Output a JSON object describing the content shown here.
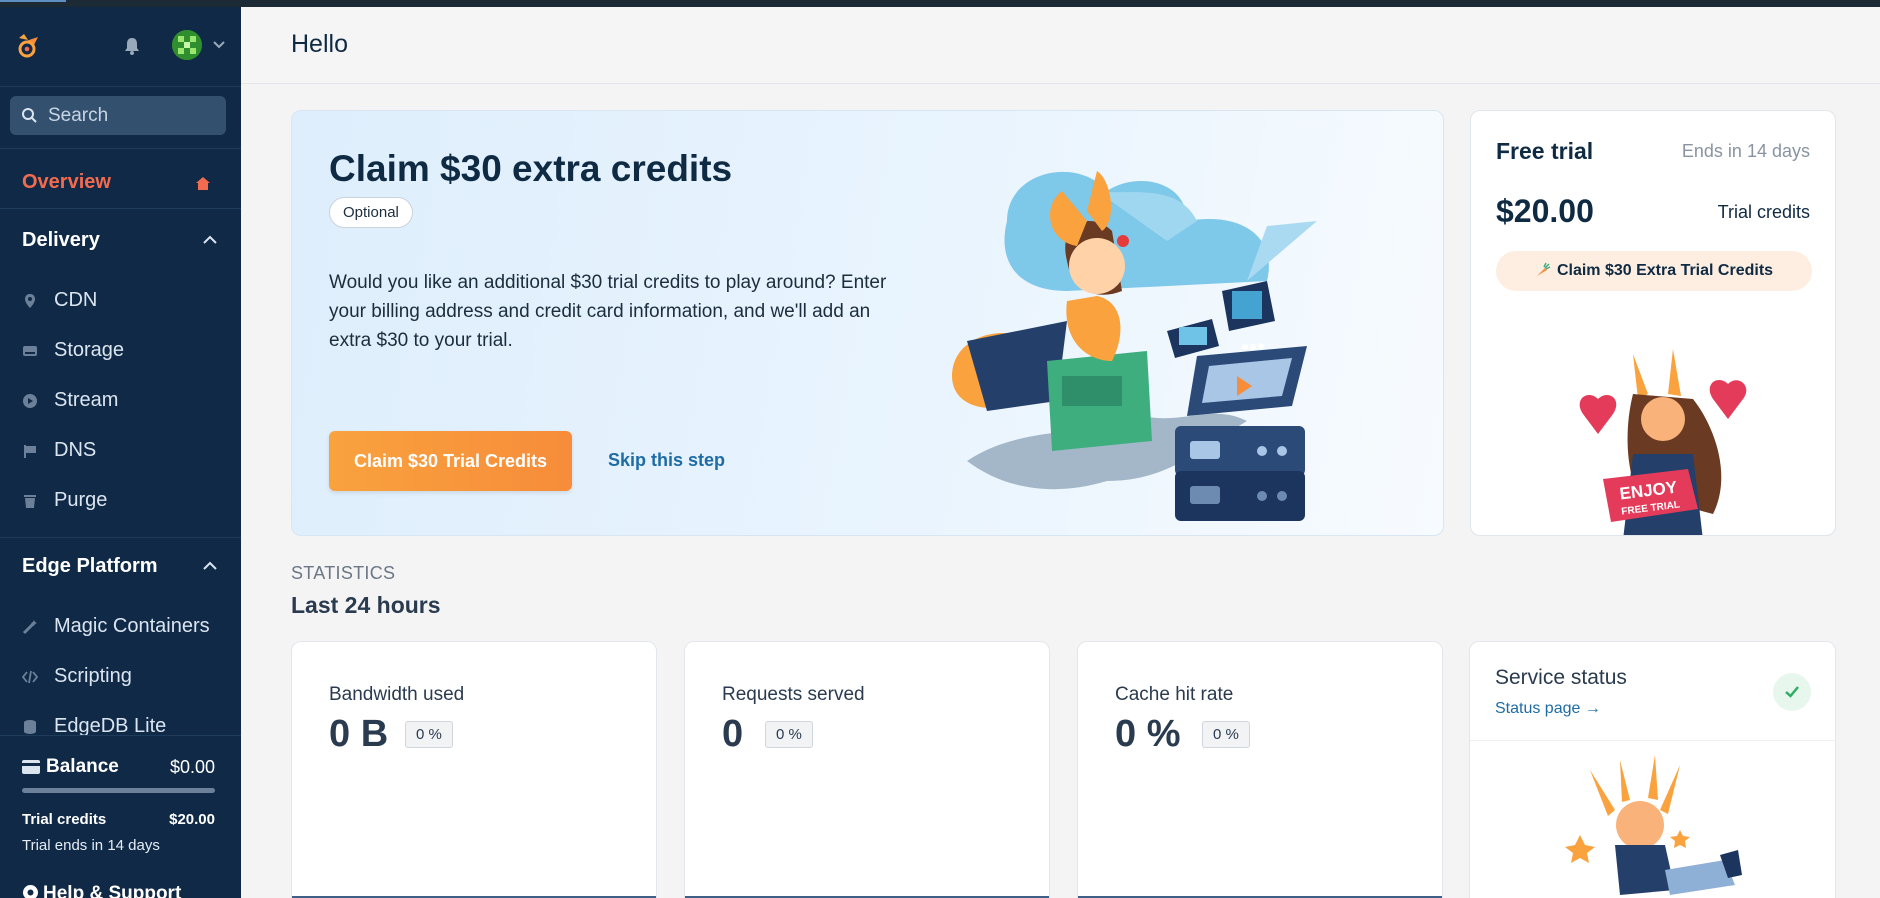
{
  "sidebar": {
    "search_placeholder": "Search",
    "overview_label": "Overview",
    "sections": [
      {
        "title": "Delivery",
        "items": [
          {
            "label": "CDN",
            "icon": "location-pin-icon"
          },
          {
            "label": "Storage",
            "icon": "storage-drive-icon"
          },
          {
            "label": "Stream",
            "icon": "play-circle-icon"
          },
          {
            "label": "DNS",
            "icon": "dns-flag-icon"
          },
          {
            "label": "Purge",
            "icon": "trash-icon"
          }
        ]
      },
      {
        "title": "Edge Platform",
        "items": [
          {
            "label": "Magic Containers",
            "icon": "magic-wand-icon"
          },
          {
            "label": "Scripting",
            "icon": "code-icon"
          },
          {
            "label": "EdgeDB Lite",
            "icon": "database-icon"
          }
        ]
      }
    ],
    "balance": {
      "title": "Balance",
      "value": "$0.00",
      "trial_credits_label": "Trial credits",
      "trial_credits_value": "$20.00",
      "trial_ends": "Trial ends in 14 days"
    },
    "help_label": "Help & Support"
  },
  "header": {
    "title": "Hello"
  },
  "promo": {
    "title": "Claim $30 extra credits",
    "pill": "Optional",
    "description": "Would you like an additional $30 trial credits to play around? Enter your billing address and credit card information, and we'll add an extra $30 to your trial.",
    "cta": "Claim $30 Trial Credits",
    "skip": "Skip this step"
  },
  "trial": {
    "title": "Free trial",
    "ends": "Ends in 14 days",
    "amount": "$20.00",
    "amount_label": "Trial credits",
    "claim_button": "Claim $30 Extra Trial Credits",
    "sign_text_1": "ENJOY",
    "sign_text_2": "FREE TRIAL"
  },
  "stats": {
    "label": "STATISTICS",
    "title": "Last 24 hours",
    "cards": [
      {
        "label": "Bandwidth used",
        "value": "0 B",
        "change": "0 %"
      },
      {
        "label": "Requests served",
        "value": "0",
        "change": "0 %"
      },
      {
        "label": "Cache hit rate",
        "value": "0 %",
        "change": "0 %"
      }
    ]
  },
  "service": {
    "title": "Service status",
    "link": "Status page →"
  },
  "colors": {
    "sidebar_bg": "#0f2946",
    "accent_orange": "#f78c3a",
    "overview_active": "#f26b4f",
    "link_blue": "#1e6ca5"
  }
}
